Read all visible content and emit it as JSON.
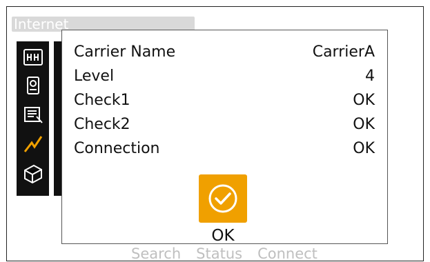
{
  "window": {
    "title": "Internet"
  },
  "background_tabs": [
    "Search",
    "Status",
    "Connect"
  ],
  "dialog": {
    "rows": [
      {
        "label": "Carrier Name",
        "value": "CarrierA"
      },
      {
        "label": "Level",
        "value": "4"
      },
      {
        "label": "Check1",
        "value": "OK"
      },
      {
        "label": "Check2",
        "value": "OK"
      },
      {
        "label": "Connection",
        "value": "OK"
      }
    ],
    "ok_label": "OK"
  },
  "sidebar_icons": [
    "keyboard-icon",
    "instrument-icon",
    "edit-document-icon",
    "lightning-icon",
    "box-icon"
  ],
  "colors": {
    "accent": "#f0a000",
    "sidebar": "#111111"
  }
}
